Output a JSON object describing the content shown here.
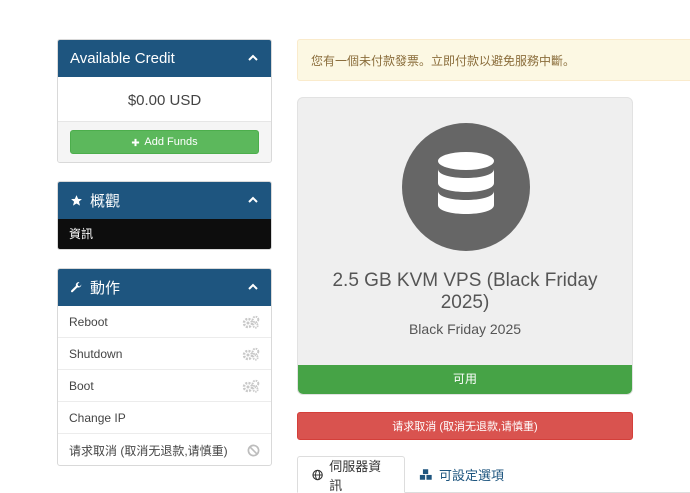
{
  "credit_panel": {
    "title": "Available Credit",
    "amount": "$0.00 USD",
    "add_funds_label": "Add Funds"
  },
  "overview_panel": {
    "title": "概觀",
    "items": [
      {
        "label": "資訊",
        "active": true
      }
    ]
  },
  "actions_panel": {
    "title": "動作",
    "items": [
      {
        "label": "Reboot",
        "icon": "gears-icon"
      },
      {
        "label": "Shutdown",
        "icon": "gears-icon"
      },
      {
        "label": "Boot",
        "icon": "gears-icon"
      },
      {
        "label": "Change IP",
        "icon": ""
      },
      {
        "label": "请求取消 (取消无退款,请慎重)",
        "icon": "ban-icon"
      }
    ]
  },
  "alert": {
    "text": "您有一個未付款發票。立即付款以避免服務中斷。"
  },
  "product": {
    "name": "2.5 GB KVM VPS (Black Friday 2025)",
    "group": "Black Friday 2025",
    "status": "可用"
  },
  "cancel_button": {
    "label": "请求取消 (取消无退款,请慎重)"
  },
  "tabs": [
    {
      "label": "伺服器資訊",
      "active": true
    },
    {
      "label": "可設定選項",
      "active": false
    }
  ],
  "colors": {
    "panel_header": "#1e557f",
    "success": "#5cb85c",
    "status_green": "#46a346",
    "danger": "#d9534f",
    "alert_bg": "#fcf8e3",
    "alert_text": "#8a6d3b"
  }
}
